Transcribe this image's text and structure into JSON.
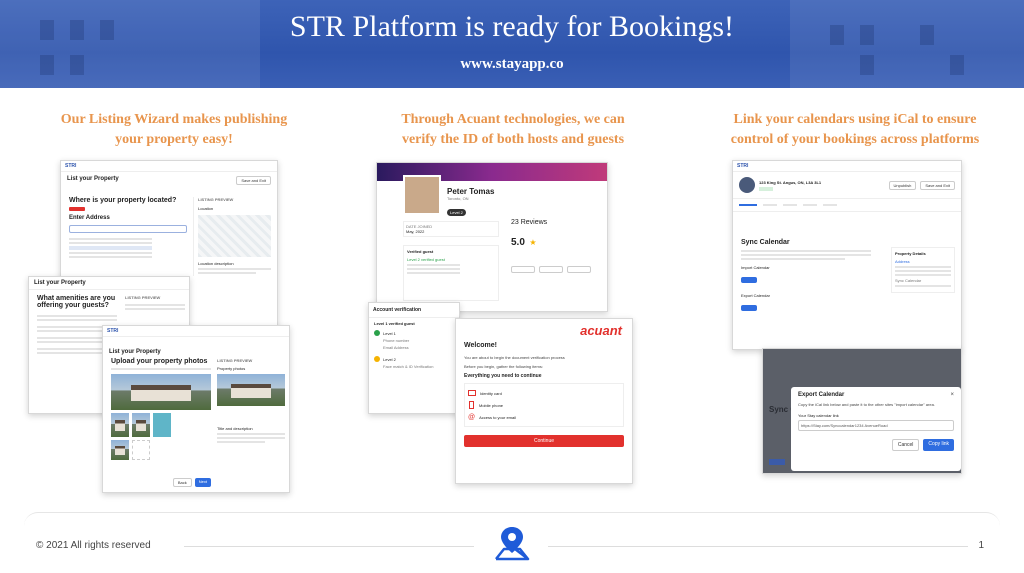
{
  "header": {
    "title": "STR Platform is ready for Bookings!",
    "url": "www.stayapp.co"
  },
  "columns": [
    {
      "heading_line1": "Our Listing Wizard makes publishing",
      "heading_line2": "your property easy!"
    },
    {
      "heading_line1": "Through Acuant technologies, we can",
      "heading_line2": "verify the ID of both hosts and guests"
    },
    {
      "heading_line1": "Link your calendars using iCal to ensure",
      "heading_line2": "control of your bookings across platforms"
    }
  ],
  "listing_wizard": {
    "brand": "STRI",
    "screen1_title": "List your Property",
    "screen1_question": "Where is your property located?",
    "screen1_enter_address": "Enter Address",
    "screen1_preview": "LISTING PREVIEW",
    "screen1_location": "Location",
    "screen1_location_desc": "Location description",
    "screen1_save_exit": "Save and Exit",
    "screen2_title": "List your Property",
    "screen2_question": "What amenities are you offering your guests?",
    "screen2_preview": "LISTING PREVIEW",
    "screen3_title": "List your Property",
    "screen3_question": "Upload your property photos",
    "screen3_preview": "LISTING PREVIEW",
    "screen3_property_photos": "Property photos",
    "screen3_title_desc": "Title and description",
    "screen3_back": "Back",
    "screen3_next": "Next"
  },
  "acuant": {
    "profile_name": "Peter Tomas",
    "profile_location": "Toronto, ON",
    "profile_level": "Level 2",
    "joined_label": "DATE JOINED",
    "joined_value": "May, 2022",
    "reviews_title": "23 Reviews",
    "rating": "5.0",
    "verified_guest": "Verified guest",
    "level2_verified": "Level 2 verified guest",
    "account_verification": "Account verification",
    "level1_verified": "Level 1 verified guest",
    "level1": "Level 1",
    "phone_number": "Phone number",
    "email_address": "Email Address",
    "level2": "Level 2",
    "face_match": "Face match & ID Verification",
    "brand": "acuant",
    "welcome": "Welcome!",
    "about_to_begin": "You are about to begin the document verification process",
    "before_begin": "Before you begin, gather the following items:",
    "everything_need": "Everything you need to continue",
    "item_identity": "Identity card",
    "item_phone": "Mobile phone",
    "item_email": "Access to your email",
    "continue": "Continue"
  },
  "ical": {
    "brand": "STRI",
    "address": "123 King St. Angus, ON, L3A 3L1",
    "unpublish": "Unpublish",
    "save_exit": "Save and Exit",
    "sync_calendar": "Sync Calendar",
    "import_calendar": "Import Calendar",
    "export_calendar": "Export Calendar",
    "property_details": "Property Details",
    "details_address": "Address",
    "details_sync": "Sync Calendar",
    "modal_title": "Export Calendar",
    "modal_desc": "Copy the iCal link below and paste it to the other sites \"import calendar\" area.",
    "modal_label": "Your Stay calendar link",
    "modal_link": "https://Stay.com/Synccalendar1234 AvenueRoad",
    "modal_cancel": "Cancel",
    "modal_copy": "Copy link",
    "bg_sync": "Sync Ca"
  },
  "footer": {
    "copyright": "© 2021 All rights reserved",
    "page": "1"
  },
  "colors": {
    "banner": "#2f55ad",
    "heading_orange": "#e8954d",
    "acuant_red": "#e2312d",
    "primary_blue": "#2f6de0"
  }
}
